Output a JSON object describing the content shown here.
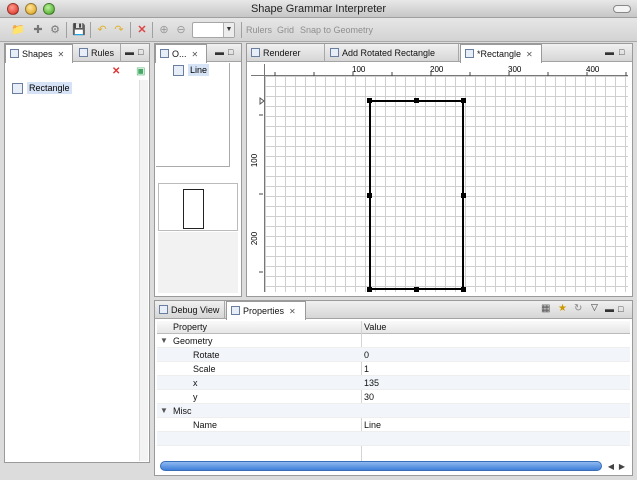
{
  "window": {
    "title": "Shape Grammar Interpreter"
  },
  "toolbar": {
    "rulers": "Rulers",
    "grid": "Grid",
    "snap": "Snap to Geometry",
    "zoom_value": ""
  },
  "shapes_pane": {
    "tabs": [
      {
        "label": "Shapes"
      },
      {
        "label": "Rules"
      }
    ],
    "items": [
      {
        "label": "Rectangle"
      }
    ]
  },
  "outline_pane": {
    "tab_label": "O...",
    "items": [
      {
        "label": "Line"
      }
    ]
  },
  "editor": {
    "tabs": [
      {
        "label": "Renderer"
      },
      {
        "label": "Add Rotated Rectangle"
      },
      {
        "label": "*Rectangle"
      }
    ],
    "ruler_h_labels": [
      "100",
      "200",
      "300",
      "400"
    ],
    "ruler_v_labels": [
      "100",
      "200"
    ]
  },
  "bottom_pane": {
    "tabs": [
      {
        "label": "Debug View"
      },
      {
        "label": "Properties"
      }
    ],
    "columns": {
      "property": "Property",
      "value": "Value"
    },
    "rows": [
      {
        "type": "group",
        "name": "Geometry",
        "value": ""
      },
      {
        "type": "prop",
        "name": "Rotate",
        "value": "0"
      },
      {
        "type": "prop",
        "name": "Scale",
        "value": "1"
      },
      {
        "type": "prop",
        "name": "x",
        "value": "135"
      },
      {
        "type": "prop",
        "name": "y",
        "value": "30"
      },
      {
        "type": "group",
        "name": "Misc",
        "value": ""
      },
      {
        "type": "prop",
        "name": "Name",
        "value": "Line"
      }
    ]
  }
}
